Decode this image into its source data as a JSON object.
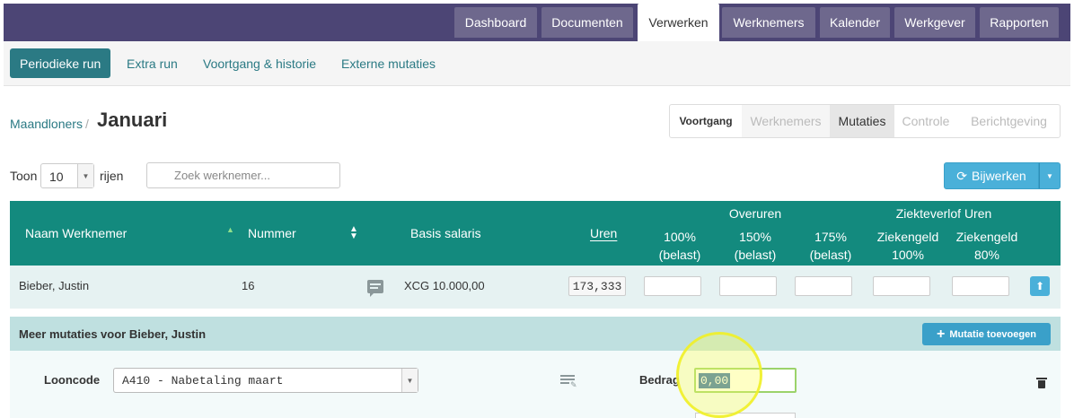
{
  "topnav": {
    "tabs": [
      {
        "label": "Dashboard"
      },
      {
        "label": "Documenten"
      },
      {
        "label": "Verwerken",
        "active": true
      },
      {
        "label": "Werknemers"
      },
      {
        "label": "Kalender"
      },
      {
        "label": "Werkgever"
      },
      {
        "label": "Rapporten"
      }
    ]
  },
  "subnav": {
    "items": [
      {
        "label": "Periodieke run",
        "active": true
      },
      {
        "label": "Extra run"
      },
      {
        "label": "Voortgang & historie"
      },
      {
        "label": "Externe mutaties"
      }
    ]
  },
  "breadcrumb": {
    "parent": "Maandloners",
    "separator": "/",
    "title": "Januari"
  },
  "steps": [
    {
      "label": "Voortgang",
      "state": "done"
    },
    {
      "label": "Werknemers",
      "state": "upcoming"
    },
    {
      "label": "Mutaties",
      "state": "current"
    },
    {
      "label": "Controle",
      "state": "upcoming"
    },
    {
      "label": "Berichtgeving",
      "state": "upcoming"
    }
  ],
  "controls": {
    "show_label": "Toon",
    "page_size": "10",
    "rows_label": "rijen",
    "search_placeholder": "Zoek werknemer...",
    "update_button": "Bijwerken"
  },
  "table": {
    "headers": {
      "name": "Naam Werknemer",
      "number": "Nummer",
      "salary": "Basis salaris",
      "hours": "Uren",
      "overtime_group": "Overuren",
      "overtime": [
        {
          "line1": "100%",
          "line2": "(belast)"
        },
        {
          "line1": "150%",
          "line2": "(belast)"
        },
        {
          "line1": "175%",
          "line2": "(belast)"
        }
      ],
      "sick_group": "Ziekteverlof Uren",
      "sick": [
        {
          "line1": "Ziekengeld",
          "line2": "100%"
        },
        {
          "line1": "Ziekengeld",
          "line2": "80%"
        }
      ]
    },
    "rows": [
      {
        "name": "Bieber, Justin",
        "number": "16",
        "salary": "XCG 10.000,00",
        "hours": "173,333"
      }
    ]
  },
  "mutations": {
    "title": "Meer mutaties voor Bieber, Justin",
    "add_button": "Mutatie toevoegen",
    "looncode_label": "Looncode",
    "looncode_value": "A410 - Nabetaling maart",
    "amount_label": "Bedrag",
    "amount_value": "0,00"
  },
  "colors": {
    "topbar": "#4c4575",
    "teal_header": "#138a7e",
    "accent_blue": "#4ab0d9",
    "link": "#2b7a84"
  }
}
